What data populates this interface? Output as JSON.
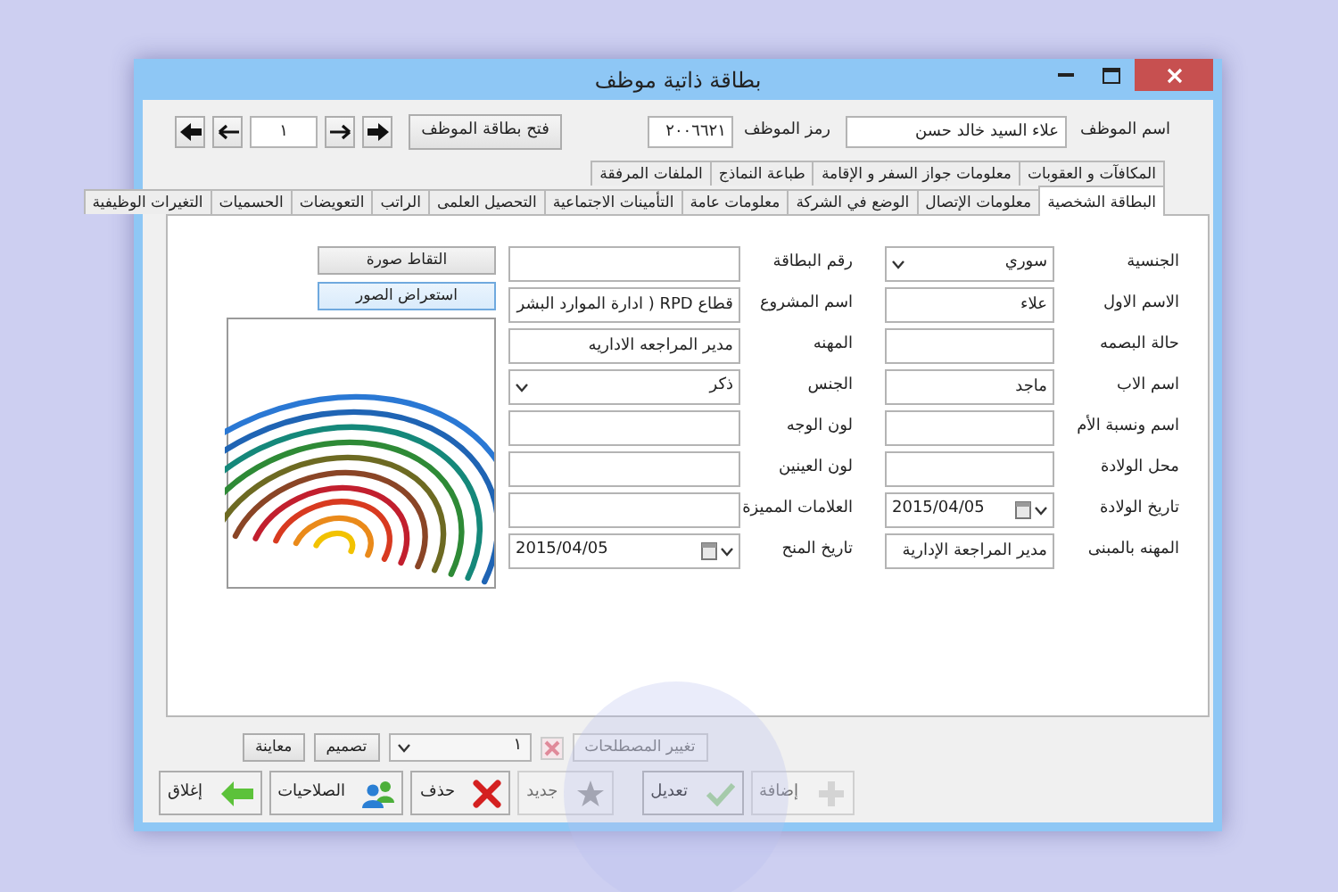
{
  "window": {
    "title": "بطاقة ذاتية موظف"
  },
  "header": {
    "employee_name_label": "اسم الموظف",
    "employee_name": "علاء السيد خالد حسن",
    "employee_code_label": "رمز الموظف",
    "employee_code": "٢٠٠٦٦٢١",
    "open_button": "فتح بطاقة الموظف",
    "record_number": "١"
  },
  "tabs": {
    "back_row": [
      {
        "label": "المكافآت و العقوبات",
        "selected": false
      },
      {
        "label": "معلومات جواز السفر و الإقامة",
        "selected": false
      },
      {
        "label": "طباعة النماذج",
        "selected": false
      },
      {
        "label": "الملفات المرفقة",
        "selected": false
      }
    ],
    "front_row": [
      {
        "label": "البطاقة الشخصية",
        "selected": true
      },
      {
        "label": "معلومات الإتصال",
        "selected": false
      },
      {
        "label": "الوضع في الشركة",
        "selected": false
      },
      {
        "label": "معلومات عامة",
        "selected": false
      },
      {
        "label": "التأمينات الاجتماعية",
        "selected": false
      },
      {
        "label": "التحصيل العلمى",
        "selected": false
      },
      {
        "label": "الراتب",
        "selected": false
      },
      {
        "label": "التعويضات",
        "selected": false
      },
      {
        "label": "الحسميات",
        "selected": false
      },
      {
        "label": "التغيرات الوظيفية",
        "selected": false
      }
    ]
  },
  "form": {
    "right_fields": [
      {
        "label": "الجنسية",
        "kind": "select",
        "value": "سوري"
      },
      {
        "label": "الاسم الاول",
        "kind": "text",
        "value": "علاء"
      },
      {
        "label": "حالة البصمه",
        "kind": "text"
      },
      {
        "label": "اسم الاب",
        "kind": "text",
        "value": "ماجد"
      },
      {
        "label": "اسم ونسبة الأم",
        "kind": "text"
      },
      {
        "label": "محل الولادة",
        "kind": "text"
      },
      {
        "label": "تاريخ الولادة",
        "kind": "date",
        "value": "2015/04/05"
      },
      {
        "label": "المهنه بالمبنى",
        "kind": "text",
        "value": "مدير المراجعة الإدارية"
      }
    ],
    "middle_fields": [
      {
        "label": "رقم البطاقة",
        "kind": "text"
      },
      {
        "label": "اسم المشروع",
        "kind": "text",
        "value": "قطاع RPD ( ادارة الموارد البشر"
      },
      {
        "label": "المهنه",
        "kind": "text",
        "value": "مدير المراجعه الاداريه"
      },
      {
        "label": "الجنس",
        "kind": "select",
        "value": "ذكر"
      },
      {
        "label": "لون الوجه",
        "kind": "text"
      },
      {
        "label": "لون العينين",
        "kind": "text"
      },
      {
        "label": "العلامات المميزة",
        "kind": "text"
      },
      {
        "label": "تاريخ المنح",
        "kind": "date",
        "value": "2015/04/05"
      }
    ],
    "photo_buttons": [
      {
        "label": "التقاط صورة",
        "selected": false
      },
      {
        "label": "استعراض الصور",
        "selected": true
      }
    ]
  },
  "bottom": {
    "design_row": [
      {
        "kind": "button",
        "label": "تغيير المصطلحات",
        "disabled": true
      },
      {
        "kind": "clear",
        "disabled": true
      },
      {
        "kind": "select",
        "value": "١"
      },
      {
        "kind": "button",
        "label": "تصميم",
        "disabled": false
      },
      {
        "kind": "button",
        "label": "معاينة",
        "disabled": false
      }
    ],
    "edit_buttons": [
      {
        "kind": "add",
        "label": "إضافة",
        "disabled": true
      },
      {
        "kind": "save",
        "label": "تعديل",
        "disabled": false
      }
    ],
    "main_buttons": [
      {
        "kind": "new",
        "label": "جديد",
        "disabled": true
      },
      {
        "kind": "delete",
        "label": "حذف",
        "disabled": false
      },
      {
        "kind": "permissions",
        "label": "الصلاحيات",
        "disabled": false
      },
      {
        "kind": "exit",
        "label": "إغلاق",
        "disabled": false
      }
    ]
  }
}
